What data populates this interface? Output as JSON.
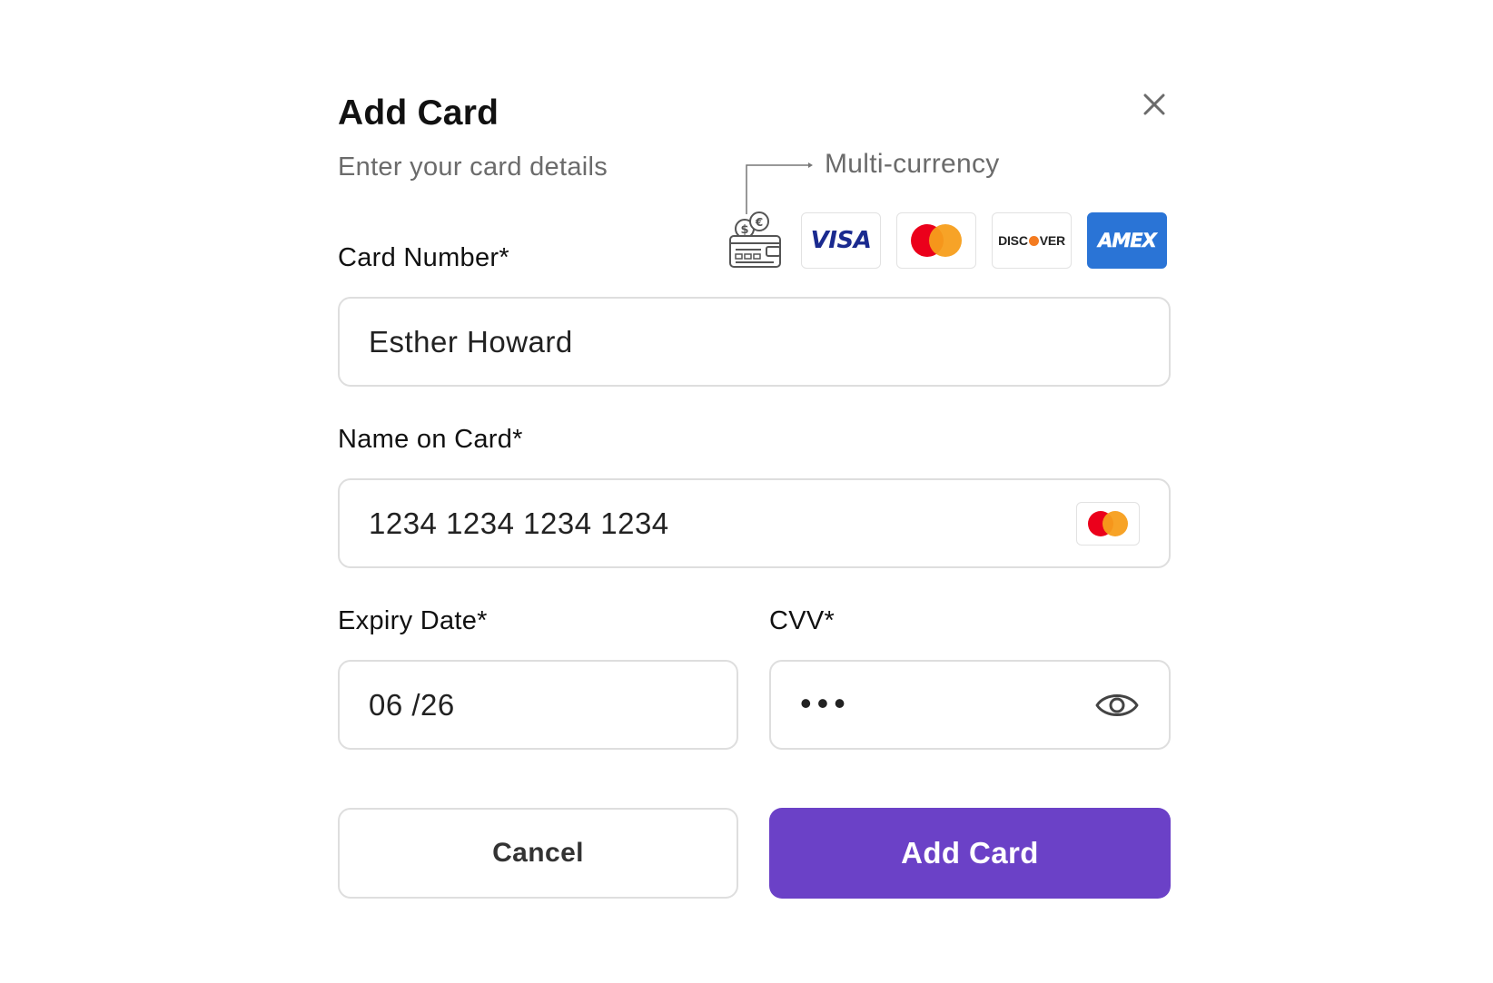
{
  "dialog": {
    "title": "Add Card",
    "subtitle": "Enter your card details"
  },
  "brands": {
    "multi_currency_label": "Multi-currency",
    "visa": "VISA",
    "discover_left": "DISC",
    "discover_right": "VER",
    "amex": "AMEX"
  },
  "fields": {
    "card_number_label": "Card Number*",
    "card_number_value": "Esther Howard",
    "name_label": "Name on Card*",
    "name_value": "1234 1234 1234 1234",
    "expiry_label": "Expiry Date*",
    "expiry_value": "06 /26",
    "cvv_label": "CVV*",
    "cvv_value": "•••"
  },
  "actions": {
    "cancel_label": "Cancel",
    "add_label": "Add Card"
  },
  "colors": {
    "primary": "#6b41c7",
    "amex_blue": "#2a74d6",
    "mc_red": "#eb001b",
    "mc_orange": "#f79e1b",
    "discover_orange": "#f47b20"
  },
  "icons": {
    "close": "close-icon",
    "wallet": "multi-currency-wallet-icon",
    "eye": "eye-icon"
  }
}
